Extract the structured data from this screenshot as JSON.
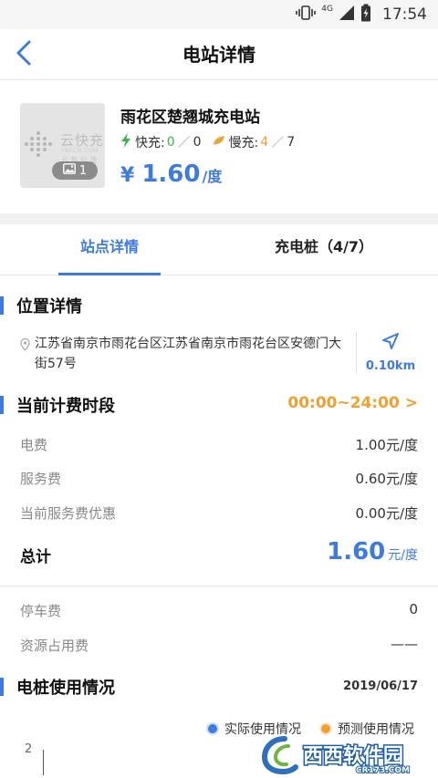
{
  "status_bar": {
    "network": "4G",
    "time": "17:54"
  },
  "header": {
    "title": "电站详情"
  },
  "station": {
    "name": "雨花区楚翘城充电站",
    "thumb_brand": "云快充",
    "thumb_sub": "YKCCN.COM",
    "thumb_sub2": "云 集 价 值",
    "photo_count": "1",
    "fast_label": "快充:",
    "fast_available": "0",
    "fast_total": "0",
    "slow_label": "慢充:",
    "slow_available": "4",
    "slow_total": "7",
    "sep": "／",
    "price_symbol": "¥",
    "price": "1.60",
    "price_unit": "/度"
  },
  "tabs": [
    {
      "label": "站点详情",
      "active": true
    },
    {
      "label": "充电桩（4/7）",
      "active": false
    }
  ],
  "location": {
    "title": "位置详情",
    "address": "江苏省南京市雨花台区江苏省南京市雨花台区安德门大街57号",
    "distance": "0.10km"
  },
  "billing": {
    "title": "当前计费时段",
    "time_range": "00:00~24:00 >",
    "rows": [
      {
        "label": "电费",
        "value": "1.00元/度"
      },
      {
        "label": "服务费",
        "value": "0.60元/度"
      },
      {
        "label": "当前服务费优惠",
        "value": "0.00元/度"
      }
    ],
    "total_label": "总计",
    "total_value": "1.60",
    "total_unit": "元/度"
  },
  "extra_fees": [
    {
      "label": "停车费",
      "value": "0"
    },
    {
      "label": "资源占用费",
      "value": "——"
    }
  ],
  "usage": {
    "title": "电桩使用情况",
    "date": "2019/06/17",
    "legend_actual": "实际使用情况",
    "legend_predicted": "预测使用情况",
    "y_tick": "2",
    "colors": {
      "actual": "#3e7bdc",
      "predicted": "#f0a030"
    }
  },
  "watermark": {
    "text": "西西软件园",
    "sub": "CR173.COM"
  },
  "colors": {
    "accent": "#3e7bdc",
    "highlight": "#f0a030",
    "green": "#3db34a"
  }
}
